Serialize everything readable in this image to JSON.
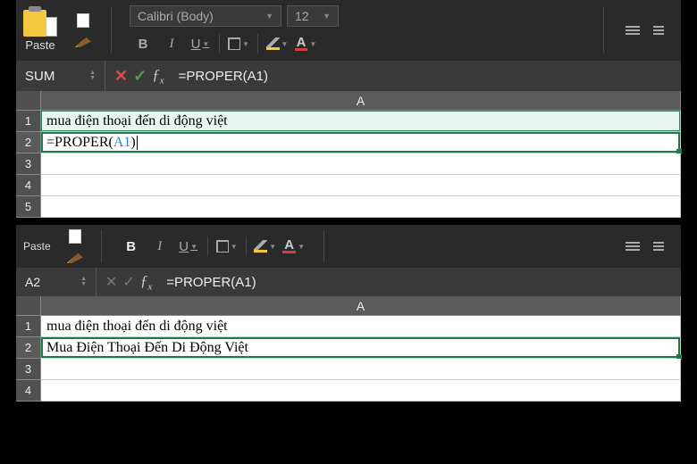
{
  "upper": {
    "ribbon": {
      "paste_label": "Paste",
      "font_name": "Calibri (Body)",
      "font_size": "12",
      "bold": "B",
      "italic": "I",
      "underline": "U",
      "font_color_glyph": "A"
    },
    "formula_bar": {
      "namebox": "SUM",
      "cancel_glyph": "✕",
      "accept_glyph": "✓",
      "fx_glyph": "ƒ",
      "fx_sub": "x",
      "formula_value": "=PROPER(A1)"
    },
    "grid": {
      "col": "A",
      "cells": {
        "a1": "mua điện thoại đến di động việt",
        "a2_prefix": "=PROPER(",
        "a2_arg": "A1",
        "a2_suffix": ")"
      },
      "rows": [
        "1",
        "2",
        "3",
        "4",
        "5"
      ]
    }
  },
  "lower": {
    "ribbon": {
      "paste_label": "Paste",
      "bold": "B",
      "italic": "I",
      "underline": "U",
      "font_color_glyph": "A"
    },
    "formula_bar": {
      "namebox": "A2",
      "cancel_glyph": "✕",
      "accept_glyph": "✓",
      "fx_glyph": "ƒ",
      "fx_sub": "x",
      "formula_value": "=PROPER(A1)"
    },
    "grid": {
      "col": "A",
      "cells": {
        "a1": "mua điện thoại đến di động việt",
        "a2": "Mua Điện Thoại Đến Di Động Việt"
      },
      "rows": [
        "1",
        "2",
        "3",
        "4"
      ]
    }
  }
}
